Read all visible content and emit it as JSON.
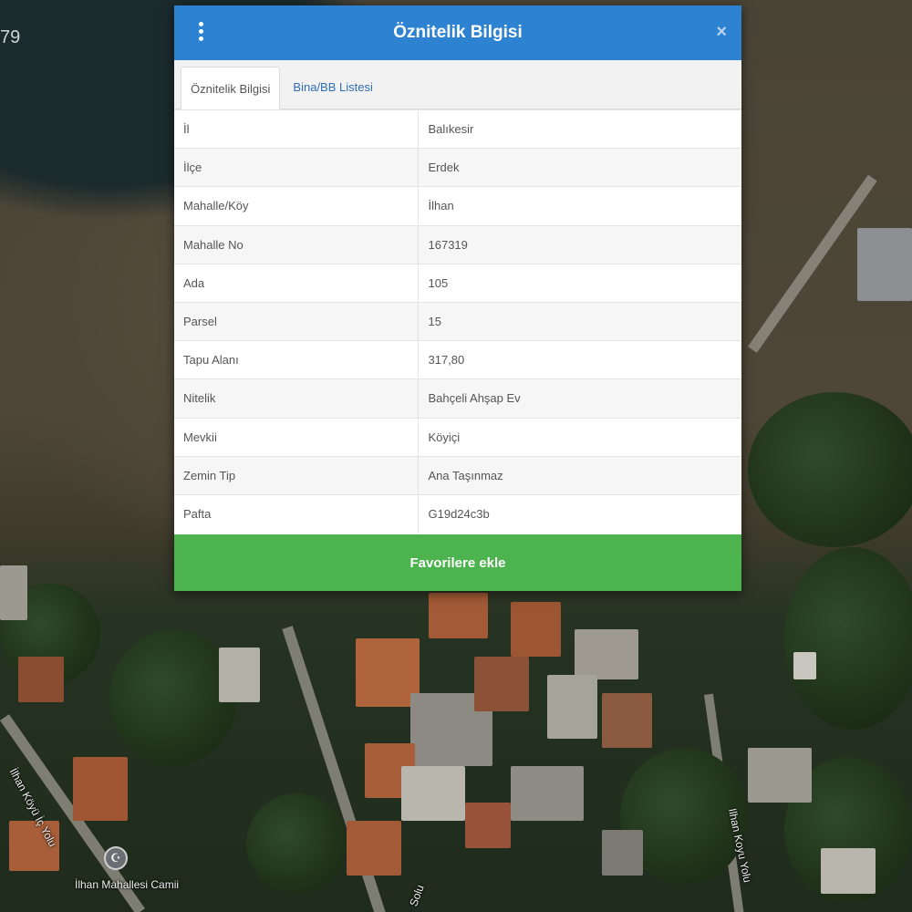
{
  "map": {
    "corner_label": "79",
    "road_labels": [
      "İlhan Köyü İç Yolu",
      "Ilhan Koyu Yolu",
      "Solu"
    ],
    "poi_label": "İlhan Mahallesi Camii",
    "poi_icon": "mosque-icon"
  },
  "dialog": {
    "title": "Öznitelik Bilgisi",
    "menu_icon": "kebab-menu-icon",
    "close_icon": "close-icon",
    "close_label": "×",
    "tabs": [
      {
        "label": "Öznitelik Bilgisi",
        "active": true
      },
      {
        "label": "Bina/BB Listesi",
        "active": false
      }
    ],
    "rows": [
      {
        "key": "İl",
        "value": "Balıkesir"
      },
      {
        "key": "İlçe",
        "value": "Erdek"
      },
      {
        "key": "Mahalle/Köy",
        "value": "İlhan"
      },
      {
        "key": "Mahalle No",
        "value": "167319"
      },
      {
        "key": "Ada",
        "value": "105"
      },
      {
        "key": "Parsel",
        "value": "15"
      },
      {
        "key": "Tapu Alanı",
        "value": "317,80"
      },
      {
        "key": "Nitelik",
        "value": "Bahçeli Ahşap Ev"
      },
      {
        "key": "Mevkii",
        "value": "Köyiçi"
      },
      {
        "key": "Zemin Tip",
        "value": "Ana Taşınmaz"
      },
      {
        "key": "Pafta",
        "value": "G19d24c3b"
      }
    ],
    "favorite_button_label": "Favorilere ekle"
  },
  "colors": {
    "header_blue": "#2d83d1",
    "button_green": "#4cb34e",
    "tab_link_blue": "#2d6fb7"
  }
}
